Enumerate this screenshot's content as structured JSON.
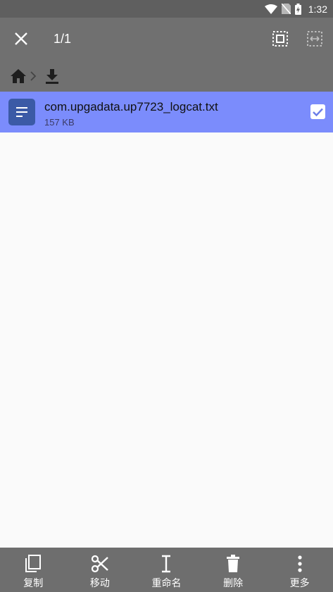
{
  "status": {
    "time": "1:32"
  },
  "toolbar": {
    "selection_count": "1/1"
  },
  "breadcrumb": {
    "items": [
      "home-icon",
      "download-icon"
    ]
  },
  "files": [
    {
      "name": "com.upgadata.up7723_logcat.txt",
      "size": "157 KB",
      "icon": "text-file-icon",
      "selected": true
    }
  ],
  "bottom_actions": [
    {
      "label": "复制",
      "icon": "copy-icon"
    },
    {
      "label": "移动",
      "icon": "cut-icon"
    },
    {
      "label": "重命名",
      "icon": "text-cursor-icon"
    },
    {
      "label": "删除",
      "icon": "trash-icon"
    },
    {
      "label": "更多",
      "icon": "more-vert-icon"
    }
  ],
  "colors": {
    "appbar": "#707070",
    "statusbar": "#5f5f5f",
    "selected_row": "#7b8cfc",
    "file_icon": "#3b5aa6",
    "bottombar": "#6e6e6e"
  }
}
